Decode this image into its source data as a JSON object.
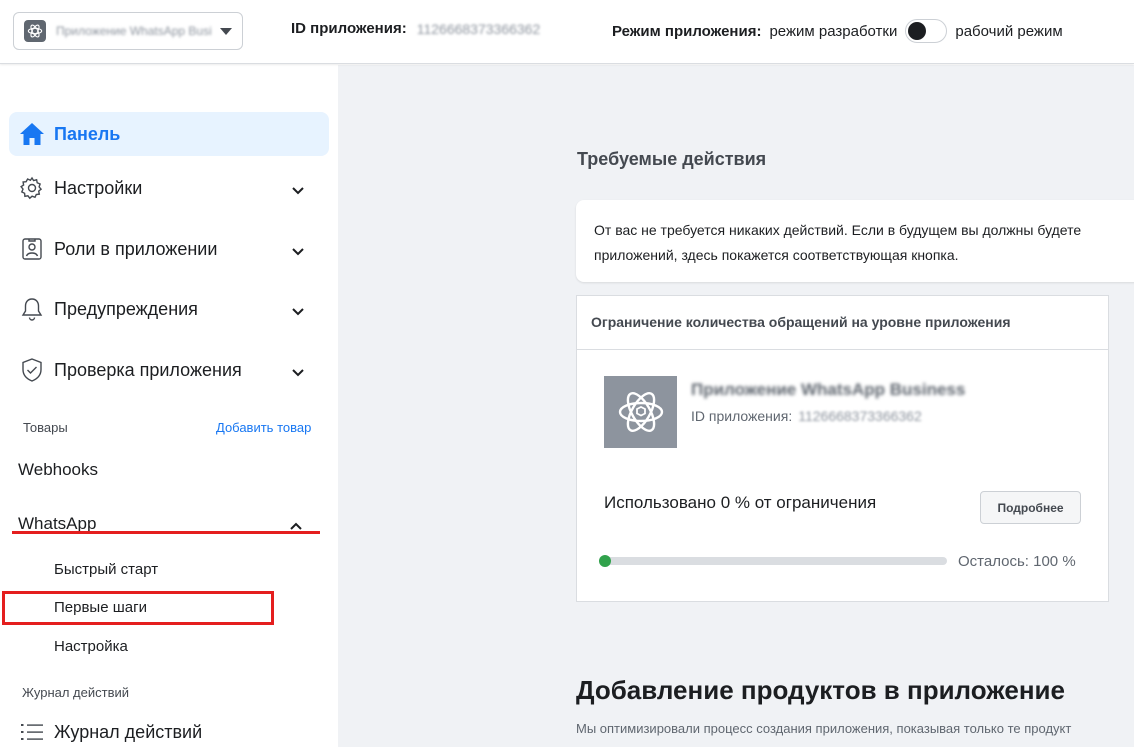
{
  "topbar": {
    "app_selector_name": "Приложение WhatsApp Business",
    "app_id_label": "ID приложения:",
    "app_id_value": "1126668373366362",
    "mode_label": "Режим приложения:",
    "mode_dev": "режим разработки",
    "mode_live": "рабочий режим"
  },
  "sidebar": {
    "dashboard": "Панель",
    "settings": "Настройки",
    "roles": "Роли в приложении",
    "alerts": "Предупреждения",
    "app_review": "Проверка приложения",
    "products_section": "Товары",
    "add_product": "Добавить товар",
    "webhooks": "Webhooks",
    "whatsapp": "WhatsApp",
    "quick_start": "Быстрый старт",
    "getting_started": "Первые шаги",
    "configuration": "Настройка",
    "activity_section": "Журнал действий",
    "activity_log": "Журнал действий"
  },
  "main": {
    "required_actions_title": "Требуемые действия",
    "notice_line1": "От вас не требуется никаких действий. Если в будущем вы должны будете",
    "notice_line2": "приложений, здесь покажется соответствующая кнопка.",
    "limit_card": {
      "header": "Ограничение количества обращений на уровне приложения",
      "app_name": "Приложение WhatsApp Business",
      "app_id_label": "ID приложения:",
      "app_id_value": "1126668373366362",
      "usage_text": "Использовано 0 % от ограничения",
      "more_button": "Подробнее",
      "usage_percent": 0,
      "remaining_text": "Осталось: 100 %"
    },
    "products_title": "Добавление продуктов в приложение",
    "products_subtitle": "Мы оптимизировали процесс создания приложения, показывая только те продукт"
  },
  "colors": {
    "accent": "#1877f2",
    "active_bg": "#e7f3ff",
    "annotation_red": "#e41e1e",
    "progress_dot": "#31a24c"
  },
  "icons": [
    "app-icon",
    "home-icon",
    "gear-icon",
    "person-card-icon",
    "bell-icon",
    "shield-check-icon",
    "chevron-down-icon",
    "chevron-up-icon",
    "list-icon",
    "atom-icon"
  ]
}
